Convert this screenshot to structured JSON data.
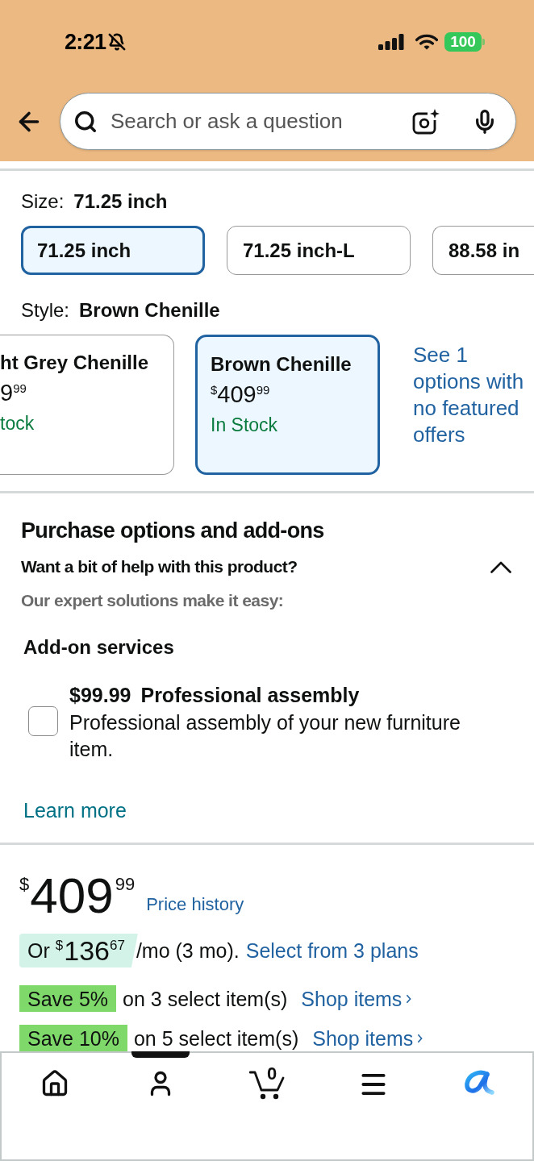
{
  "status_bar": {
    "time": "2:21",
    "battery": "100"
  },
  "search": {
    "placeholder": "Search or ask a question"
  },
  "size": {
    "label": "Size:",
    "value": "71.25 inch",
    "options": [
      {
        "label": "71.25 inch",
        "selected": true
      },
      {
        "label": "71.25 inch-L",
        "selected": false
      },
      {
        "label": "88.58 in",
        "selected": false
      }
    ]
  },
  "style": {
    "label": "Style:",
    "value": "Brown Chenille",
    "options": [
      {
        "name": "ht Grey Chenille",
        "price_whole": "9",
        "price_fraction": "99",
        "availability": "tock",
        "selected": false
      },
      {
        "name": "Brown Chenille",
        "currency": "$",
        "price_whole": "409",
        "price_fraction": "99",
        "availability": "In Stock",
        "selected": true
      }
    ],
    "more_link": "See 1 options with no featured offers"
  },
  "purchase_options": {
    "title": "Purchase options and add-ons",
    "subtitle": "Want a bit of help with this product?",
    "expanded": true,
    "note": "Our expert solutions make it easy:",
    "addons_title": "Add-on services",
    "addons": [
      {
        "price": "$99.99",
        "name": "Professional assembly",
        "description": "Professional assembly of your new furniture item.",
        "checked": false
      }
    ],
    "learn_more": "Learn more"
  },
  "price": {
    "currency": "$",
    "whole": "409",
    "fraction": "99",
    "history_link": "Price history"
  },
  "installment": {
    "prefix": "Or",
    "currency": "$",
    "whole": "136",
    "fraction": "67",
    "suffix": "/mo (3 mo).",
    "link": "Select from 3 plans"
  },
  "promotions": [
    {
      "badge": "Save 5%",
      "text": "on 3 select item(s)",
      "link": "Shop items"
    },
    {
      "badge": "Save 10%",
      "text": "on 5 select item(s)",
      "link": "Shop items"
    }
  ],
  "bottom_nav": [
    {
      "kind": "home",
      "selected": false
    },
    {
      "kind": "account",
      "selected": true
    },
    {
      "kind": "cart",
      "selected": false,
      "count": "0"
    },
    {
      "kind": "menu",
      "selected": false
    },
    {
      "kind": "assistant",
      "selected": false
    }
  ]
}
